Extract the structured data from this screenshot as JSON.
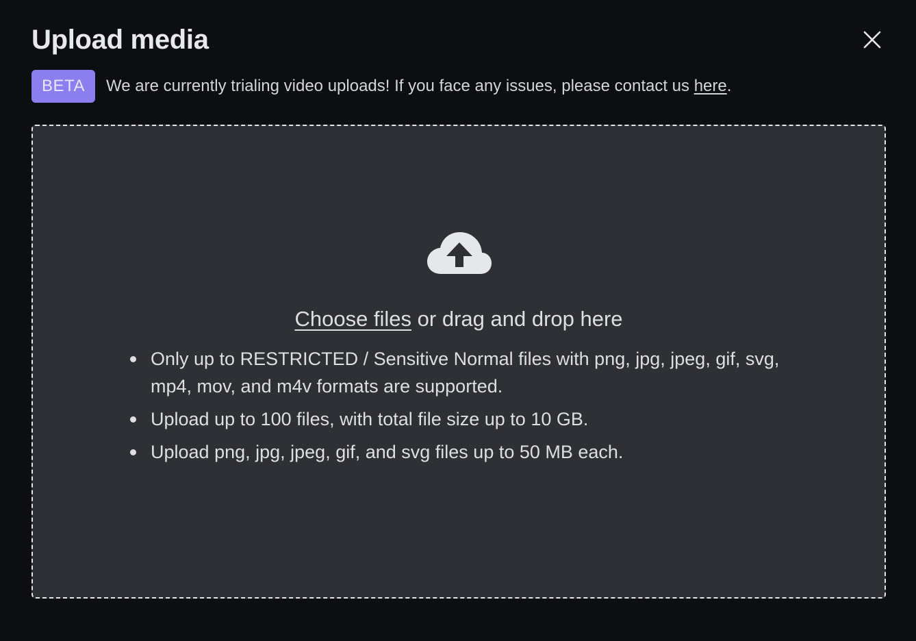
{
  "modal": {
    "title": "Upload media",
    "close_icon": "close-icon"
  },
  "notice": {
    "badge": "BETA",
    "text": "We are currently trialing video uploads! If you face any issues, please contact us ",
    "link": "here",
    "trailing": "."
  },
  "dropzone": {
    "icon": "cloud-upload-icon",
    "choose_link": "Choose files",
    "choose_rest": " or drag and drop here",
    "rules": [
      "Only up to RESTRICTED / Sensitive Normal files with png, jpg, jpeg, gif, svg, mp4, mov, and m4v formats are supported.",
      "Upload up to 100 files, with total file size up to 10 GB.",
      "Upload png, jpg, jpeg, gif, and svg files up to 50 MB each."
    ]
  },
  "colors": {
    "background": "#0d0e11",
    "dropzone": "#2e3035",
    "badge": "#8b7ff0"
  }
}
